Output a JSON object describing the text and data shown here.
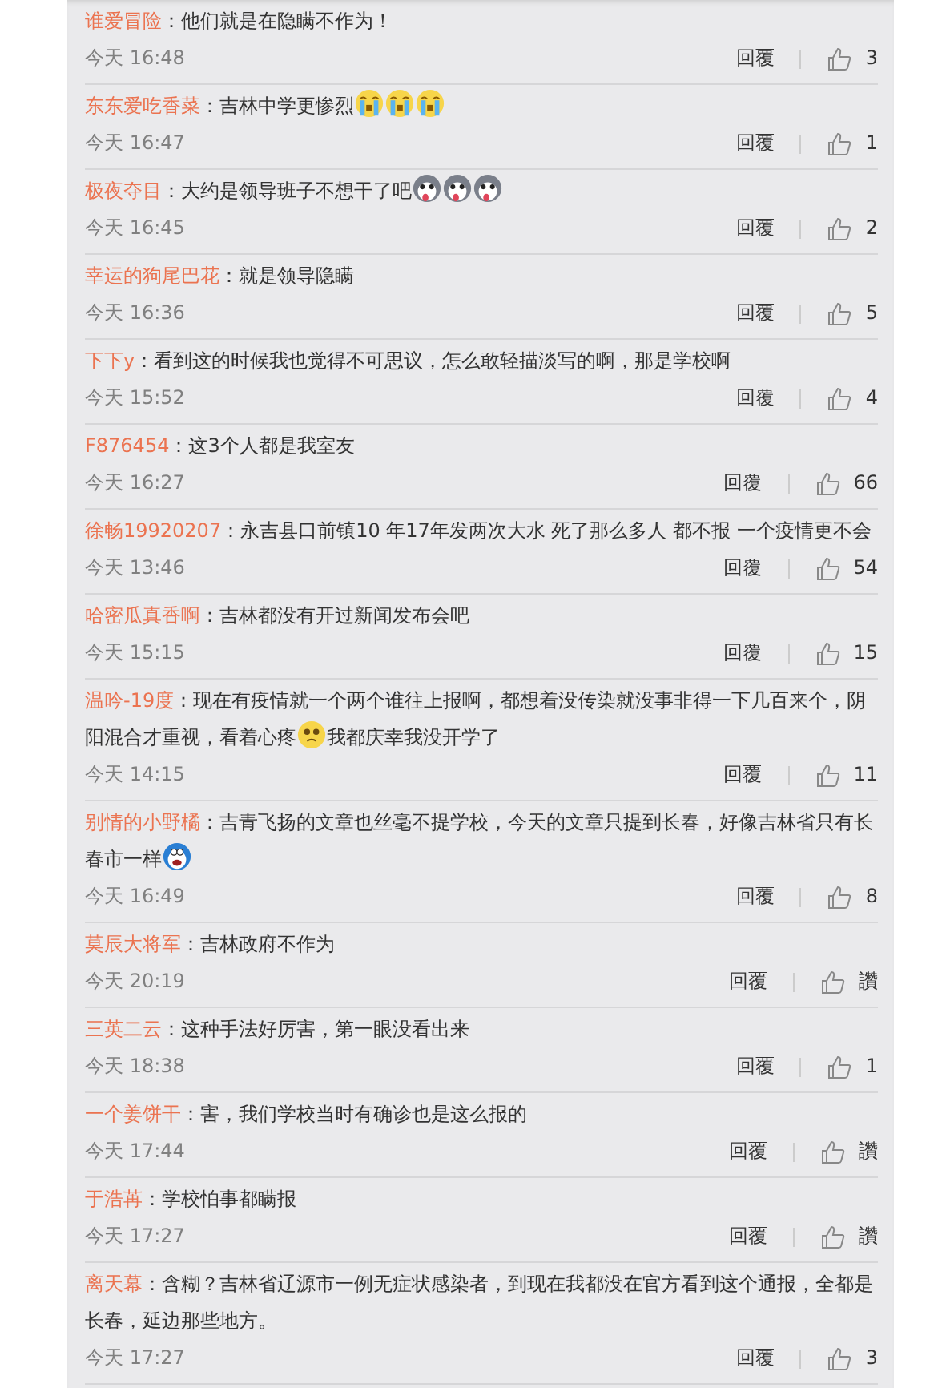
{
  "comments": [
    {
      "user": "谁爱冒险",
      "parts": [
        {
          "text": "：他们就是在隐瞒不作为！"
        }
      ],
      "time": "今天 16:48",
      "reply": "回覆",
      "likes": "3"
    },
    {
      "user": "东东爱吃香菜",
      "parts": [
        {
          "text": "：吉林中学更惨烈"
        },
        {
          "kind": "cry"
        },
        {
          "kind": "cry"
        },
        {
          "kind": "cry"
        }
      ],
      "time": "今天 16:47",
      "reply": "回覆",
      "likes": "1"
    },
    {
      "user": "极夜夺目",
      "parts": [
        {
          "text": "：大约是领导班子不想干了吧"
        },
        {
          "kind": "husky"
        },
        {
          "kind": "husky"
        },
        {
          "kind": "husky"
        }
      ],
      "time": "今天 16:45",
      "reply": "回覆",
      "likes": "2"
    },
    {
      "user": "幸运的狗尾巴花",
      "parts": [
        {
          "text": "：就是领导隐瞒"
        }
      ],
      "time": "今天 16:36",
      "reply": "回覆",
      "likes": "5"
    },
    {
      "user": "下下y",
      "parts": [
        {
          "text": "：看到这的时候我也觉得不可思议，怎么敢轻描淡写的啊，那是学校啊"
        }
      ],
      "time": "今天 15:52",
      "reply": "回覆",
      "likes": "4"
    },
    {
      "user": "F876454",
      "parts": [
        {
          "text": "：这3个人都是我室友"
        }
      ],
      "time": "今天 16:27",
      "reply": "回覆",
      "likes": "66"
    },
    {
      "user": "徐畅19920207",
      "parts": [
        {
          "text": "：永吉县口前镇10 年17年发两次大水 死了那么多人 都不报 一个疫情更不会"
        }
      ],
      "time": "今天 13:46",
      "reply": "回覆",
      "likes": "54"
    },
    {
      "user": "哈密瓜真香啊",
      "parts": [
        {
          "text": "：吉林都没有开过新闻发布会吧"
        }
      ],
      "time": "今天 15:15",
      "reply": "回覆",
      "likes": "15"
    },
    {
      "user": "温吟-19度",
      "parts": [
        {
          "text": "：现在有疫情就一个两个谁往上报啊，都想着没传染就没事非得一下几百来个，阴阳混合才重视，看着心疼"
        },
        {
          "kind": "tearful"
        },
        {
          "text": "我都庆幸我没开学了"
        }
      ],
      "time": "今天 14:15",
      "reply": "回覆",
      "likes": "11"
    },
    {
      "user": "别情的小野橘",
      "parts": [
        {
          "text": "：吉青飞扬的文章也丝毫不提学校，今天的文章只提到长春，好像吉林省只有长春市一样"
        },
        {
          "kind": "robot"
        }
      ],
      "time": "今天 16:49",
      "reply": "回覆",
      "likes": "8"
    },
    {
      "user": "莫辰大将军",
      "parts": [
        {
          "text": "：吉林政府不作为"
        }
      ],
      "time": "今天 20:19",
      "reply": "回覆",
      "likes": "讚"
    },
    {
      "user": "三英二云",
      "parts": [
        {
          "text": "：这种手法好厉害，第一眼没看出来"
        }
      ],
      "time": "今天 18:38",
      "reply": "回覆",
      "likes": "1"
    },
    {
      "user": "一个姜饼干",
      "parts": [
        {
          "text": "：害，我们学校当时有确诊也是这么报的"
        }
      ],
      "time": "今天 17:44",
      "reply": "回覆",
      "likes": "讚"
    },
    {
      "user": "于浩苒",
      "parts": [
        {
          "text": "：学校怕事都瞒报"
        }
      ],
      "time": "今天 17:27",
      "reply": "回覆",
      "likes": "讚"
    },
    {
      "user": "离天幕",
      "parts": [
        {
          "text": "：含糊？吉林省辽源市一例无症状感染者，到现在我都没在官方看到这个通报，全都是长春，延边那些地方。"
        }
      ],
      "time": "今天 17:27",
      "reply": "回覆",
      "likes": "3"
    }
  ]
}
